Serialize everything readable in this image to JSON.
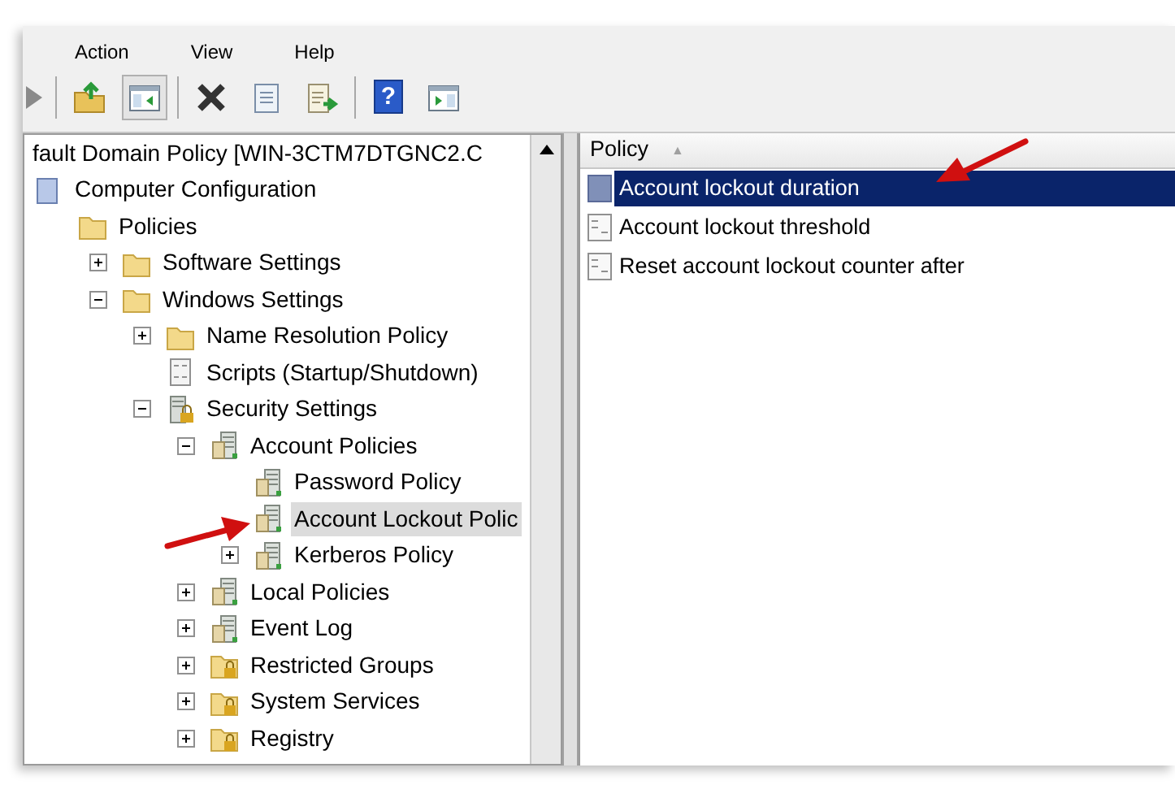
{
  "menu": [
    "Action",
    "View",
    "Help"
  ],
  "toolbar": [
    {
      "kind": "forward",
      "pressed": false
    },
    {
      "kind": "separator"
    },
    {
      "kind": "up-folder",
      "pressed": false
    },
    {
      "kind": "tree-toggle",
      "pressed": true
    },
    {
      "kind": "separator"
    },
    {
      "kind": "delete",
      "pressed": false
    },
    {
      "kind": "properties",
      "pressed": false
    },
    {
      "kind": "export",
      "pressed": false
    },
    {
      "kind": "separator"
    },
    {
      "kind": "help",
      "pressed": false,
      "glyph": "?"
    },
    {
      "kind": "pane-toggle",
      "pressed": false
    }
  ],
  "tree": [
    {
      "label": "fault Domain Policy [WIN-3CTM7DTGNC2.C",
      "selected": false,
      "children": [
        {
          "label": "Computer Configuration",
          "kind": "policy",
          "selected": false,
          "children": [
            {
              "label": "Policies",
              "kind": "folder",
              "selected": false,
              "children": [
                {
                  "label": "Software Settings",
                  "kind": "folder",
                  "expanded": false,
                  "selected": false
                },
                {
                  "label": "Windows Settings",
                  "kind": "folder",
                  "expanded": true,
                  "selected": false,
                  "children": [
                    {
                      "label": "Name Resolution Policy",
                      "kind": "folder",
                      "expanded": false,
                      "selected": false
                    },
                    {
                      "label": "Scripts (Startup/Shutdown)",
                      "kind": "script",
                      "selected": false
                    },
                    {
                      "label": "Security Settings",
                      "kind": "security",
                      "expanded": true,
                      "selected": false,
                      "children": [
                        {
                          "label": "Account Policies",
                          "kind": "server",
                          "expanded": true,
                          "selected": false,
                          "children": [
                            {
                              "label": "Password Policy",
                              "kind": "server",
                              "selected": false
                            },
                            {
                              "label": "Account Lockout Polic",
                              "kind": "server",
                              "selected": true
                            },
                            {
                              "label": "Kerberos Policy",
                              "kind": "server",
                              "expanded": false,
                              "selected": false
                            }
                          ]
                        },
                        {
                          "label": "Local Policies",
                          "kind": "server",
                          "expanded": false,
                          "selected": false
                        },
                        {
                          "label": "Event Log",
                          "kind": "server",
                          "expanded": false,
                          "selected": false
                        },
                        {
                          "label": "Restricted Groups",
                          "kind": "lockfolder",
                          "expanded": false,
                          "selected": false
                        },
                        {
                          "label": "System Services",
                          "kind": "lockfolder",
                          "expanded": false,
                          "selected": false
                        },
                        {
                          "label": "Registry",
                          "kind": "lockfolder",
                          "expanded": false,
                          "selected": false
                        }
                      ]
                    }
                  ]
                }
              ]
            }
          ]
        }
      ]
    }
  ],
  "list": {
    "header": {
      "label": "Policy",
      "sort_glyph": "▲"
    },
    "rows": [
      {
        "label": "Account lockout duration",
        "selected": true
      },
      {
        "label": "Account lockout threshold",
        "selected": false
      },
      {
        "label": "Reset account lockout counter after",
        "selected": false
      }
    ]
  }
}
